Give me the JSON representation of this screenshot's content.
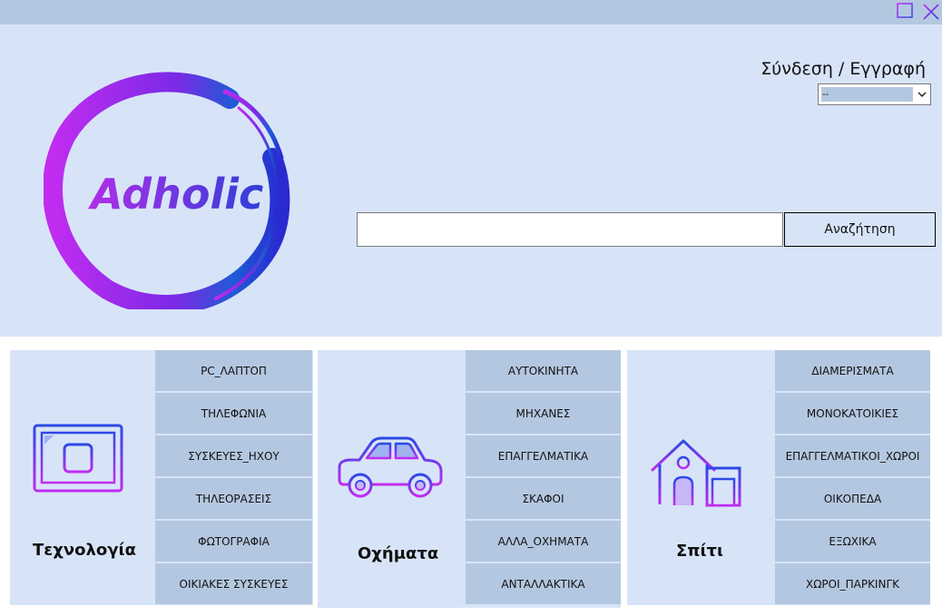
{
  "window": {
    "minimize_icon": "minimize-icon",
    "close_icon": "close-icon"
  },
  "header": {
    "logo_text": "Adholic",
    "login_label": "Σύνδεση / Εγγραφή",
    "login_select_value": "--",
    "search_placeholder": "",
    "search_button_label": "Αναζήτηση"
  },
  "categories": [
    {
      "title": "Τεχνολογία",
      "icon": "monitor-icon",
      "items": [
        "PC_ΛΑΠΤΟΠ",
        "ΤΗΛΕΦΩΝΙΑ",
        "ΣΥΣΚΕΥΕΣ_ΗΧΟΥ",
        "ΤΗΛΕΟΡΑΣΕΙΣ",
        "ΦΩΤΟΓΡΑΦΙΑ",
        "ΟΙΚΙΑΚΕΣ ΣΥΣΚΕΥΕΣ"
      ]
    },
    {
      "title": "Οχήματα",
      "icon": "car-icon",
      "items": [
        "ΑΥΤΟΚΙΝΗΤΑ",
        "ΜΗΧΑΝΕΣ",
        "ΕΠΑΓΓΕΛΜΑΤΙΚΑ",
        "ΣΚΑΦΟΙ",
        "ΑΛΛΑ_ΟΧΗΜΑΤΑ",
        "ΑΝΤΑΛΛΑΚΤΙΚΑ"
      ]
    },
    {
      "title": "Σπίτι",
      "icon": "house-icon",
      "items": [
        "ΔΙΑΜΕΡΙΣΜΑΤΑ",
        "ΜΟΝΟΚΑΤΟΙΚΙΕΣ",
        "ΕΠΑΓΓΕΛΜΑΤΙΚΟΙ_ΧΩΡΟΙ",
        "ΟΙΚΟΠΕΔΑ",
        "ΕΞΩΧΙΚΑ",
        "ΧΩΡΟΙ_ΠΑΡΚΙΝΓΚ"
      ]
    }
  ],
  "colors": {
    "titlebar": "#b4c7e0",
    "panel": "#d7e4f8",
    "button": "#b4c7e0",
    "accent_purple": "#c12cf0",
    "accent_blue": "#2b49e6"
  }
}
